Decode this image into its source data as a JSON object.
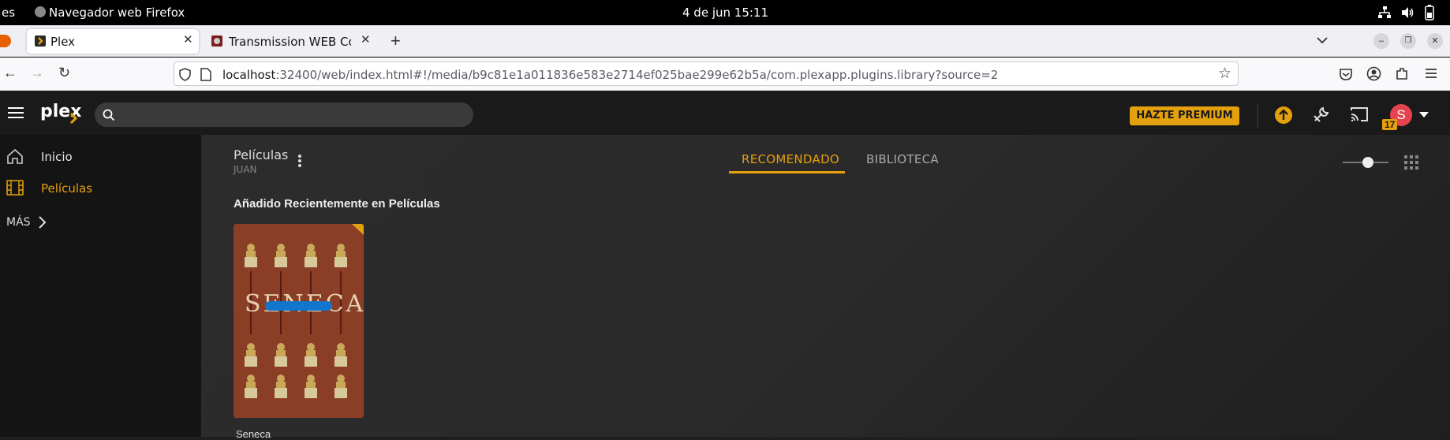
{
  "system": {
    "activities_partial": "es",
    "app_name": "Navegador web Firefox",
    "clock": "4 de jun  15:11"
  },
  "browser": {
    "tabs": [
      {
        "label": "Plex",
        "active": true
      },
      {
        "label": "Transmission WEB Control",
        "active": false
      }
    ],
    "url_host": "localhost",
    "url_rest": ":32400/web/index.html#!/media/b9c81e1a011836e583e2714ef025bae299e62b5a/com.plexapp.plugins.library?source=2"
  },
  "plex": {
    "logo": "plex",
    "premium_label": "HAZTE PREMIUM",
    "user_initial": "S",
    "badge_count": "17",
    "sidebar": {
      "items": [
        {
          "label": "Inicio",
          "icon": "home-icon",
          "active": false
        },
        {
          "label": "Películas",
          "icon": "film-icon",
          "active": true
        }
      ],
      "more_label": "MÁS"
    },
    "library": {
      "title": "Películas",
      "owner": "JUAN"
    },
    "tabs": [
      {
        "label": "RECOMENDADO",
        "active": true
      },
      {
        "label": "BIBLIOTECA",
        "active": false
      }
    ],
    "section_title": "Añadido Recientemente en Películas",
    "items": [
      {
        "title": "Seneca",
        "poster_text": "SENECA"
      }
    ]
  },
  "colors": {
    "accent": "#e5a00d",
    "avatar": "#e5434f",
    "poster": "#8a3e26"
  }
}
